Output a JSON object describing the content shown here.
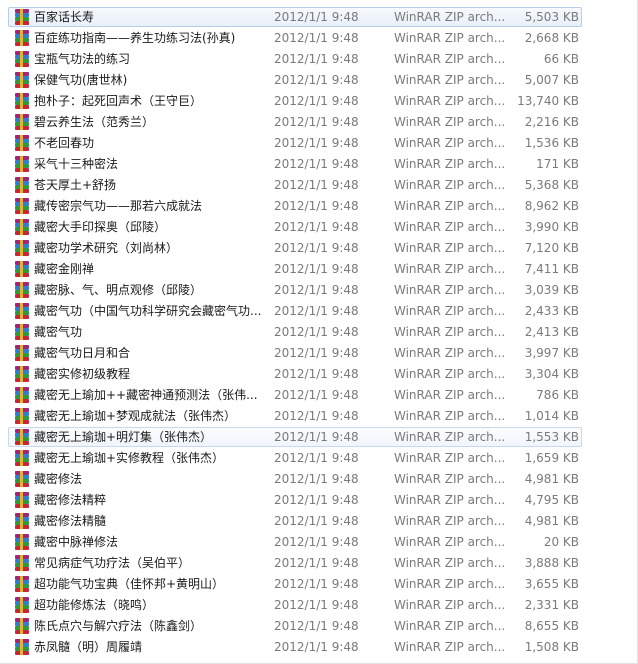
{
  "colors": {
    "selection_border": "#b7cde8",
    "selection_fill": "#e9f0f9",
    "meta_text": "#7a7a7a"
  },
  "files": [
    {
      "name": "百家话长寿",
      "date": "2012/1/1 9:48",
      "type": "WinRAR ZIP arch...",
      "size": "5,503 KB",
      "state": "selected"
    },
    {
      "name": "百症练功指南——养生功练习法(孙真)",
      "date": "2012/1/1 9:48",
      "type": "WinRAR ZIP arch...",
      "size": "2,668 KB",
      "state": ""
    },
    {
      "name": "宝瓶气功法的练习",
      "date": "2012/1/1 9:48",
      "type": "WinRAR ZIP arch...",
      "size": "66 KB",
      "state": ""
    },
    {
      "name": "保健气功(唐世林)",
      "date": "2012/1/1 9:48",
      "type": "WinRAR ZIP arch...",
      "size": "5,007 KB",
      "state": ""
    },
    {
      "name": "抱朴子：起死回声术（王守巨）",
      "date": "2012/1/1 9:48",
      "type": "WinRAR ZIP arch...",
      "size": "13,740 KB",
      "state": ""
    },
    {
      "name": "碧云养生法（范秀兰）",
      "date": "2012/1/1 9:48",
      "type": "WinRAR ZIP arch...",
      "size": "2,216 KB",
      "state": ""
    },
    {
      "name": "不老回春功",
      "date": "2012/1/1 9:48",
      "type": "WinRAR ZIP arch...",
      "size": "1,536 KB",
      "state": ""
    },
    {
      "name": "采气十三种密法",
      "date": "2012/1/1 9:48",
      "type": "WinRAR ZIP arch...",
      "size": "171 KB",
      "state": ""
    },
    {
      "name": "苍天厚土+舒扬",
      "date": "2012/1/1 9:48",
      "type": "WinRAR ZIP arch...",
      "size": "5,368 KB",
      "state": ""
    },
    {
      "name": "藏传密宗气功——那若六成就法",
      "date": "2012/1/1 9:48",
      "type": "WinRAR ZIP arch...",
      "size": "8,962 KB",
      "state": ""
    },
    {
      "name": "藏密大手印探奥（邱陵）",
      "date": "2012/1/1 9:48",
      "type": "WinRAR ZIP arch...",
      "size": "3,990 KB",
      "state": ""
    },
    {
      "name": "藏密功学术研究（刘尚林）",
      "date": "2012/1/1 9:48",
      "type": "WinRAR ZIP arch...",
      "size": "7,120 KB",
      "state": ""
    },
    {
      "name": "藏密金刚禅",
      "date": "2012/1/1 9:48",
      "type": "WinRAR ZIP arch...",
      "size": "7,411 KB",
      "state": ""
    },
    {
      "name": "藏密脉、气、明点观修（邱陵）",
      "date": "2012/1/1 9:48",
      "type": "WinRAR ZIP arch...",
      "size": "3,039 KB",
      "state": ""
    },
    {
      "name": "藏密气功（中国气功科学研究会藏密气功...",
      "date": "2012/1/1 9:48",
      "type": "WinRAR ZIP arch...",
      "size": "2,433 KB",
      "state": ""
    },
    {
      "name": "藏密气功",
      "date": "2012/1/1 9:48",
      "type": "WinRAR ZIP arch...",
      "size": "2,413 KB",
      "state": ""
    },
    {
      "name": "藏密气功日月和合",
      "date": "2012/1/1 9:48",
      "type": "WinRAR ZIP arch...",
      "size": "3,997 KB",
      "state": ""
    },
    {
      "name": "藏密实修初级教程",
      "date": "2012/1/1 9:48",
      "type": "WinRAR ZIP arch...",
      "size": "3,304 KB",
      "state": ""
    },
    {
      "name": "藏密无上瑜加++藏密神通预测法（张伟...",
      "date": "2012/1/1 9:48",
      "type": "WinRAR ZIP arch...",
      "size": "786 KB",
      "state": ""
    },
    {
      "name": "藏密无上瑜珈+梦观成就法（张伟杰）",
      "date": "2012/1/1 9:48",
      "type": "WinRAR ZIP arch...",
      "size": "1,014 KB",
      "state": ""
    },
    {
      "name": "藏密无上瑜珈+明灯集（张伟杰）",
      "date": "2012/1/1 9:48",
      "type": "WinRAR ZIP arch...",
      "size": "1,553 KB",
      "state": "hover"
    },
    {
      "name": "藏密无上瑜珈+实修教程（张伟杰）",
      "date": "2012/1/1 9:48",
      "type": "WinRAR ZIP arch...",
      "size": "1,659 KB",
      "state": ""
    },
    {
      "name": "藏密修法",
      "date": "2012/1/1 9:48",
      "type": "WinRAR ZIP arch...",
      "size": "4,981 KB",
      "state": ""
    },
    {
      "name": "藏密修法精粹",
      "date": "2012/1/1 9:48",
      "type": "WinRAR ZIP arch...",
      "size": "4,795 KB",
      "state": ""
    },
    {
      "name": "藏密修法精髓",
      "date": "2012/1/1 9:48",
      "type": "WinRAR ZIP arch...",
      "size": "4,981 KB",
      "state": ""
    },
    {
      "name": "藏密中脉禅修法",
      "date": "2012/1/1 9:48",
      "type": "WinRAR ZIP arch...",
      "size": "20 KB",
      "state": ""
    },
    {
      "name": "常见病症气功疗法（吴伯平）",
      "date": "2012/1/1 9:48",
      "type": "WinRAR ZIP arch...",
      "size": "3,888 KB",
      "state": ""
    },
    {
      "name": "超功能气功宝典（佳怀邦+黄明山）",
      "date": "2012/1/1 9:48",
      "type": "WinRAR ZIP arch...",
      "size": "3,655 KB",
      "state": ""
    },
    {
      "name": "超功能修炼法（晓鸣）",
      "date": "2012/1/1 9:48",
      "type": "WinRAR ZIP arch...",
      "size": "2,331 KB",
      "state": ""
    },
    {
      "name": "陈氏点穴与解穴疗法（陈鑫剑）",
      "date": "2012/1/1 9:48",
      "type": "WinRAR ZIP arch...",
      "size": "8,655 KB",
      "state": ""
    },
    {
      "name": "赤凤髓（明）周履靖",
      "date": "2012/1/1 9:48",
      "type": "WinRAR ZIP arch...",
      "size": "1,508 KB",
      "state": ""
    }
  ]
}
